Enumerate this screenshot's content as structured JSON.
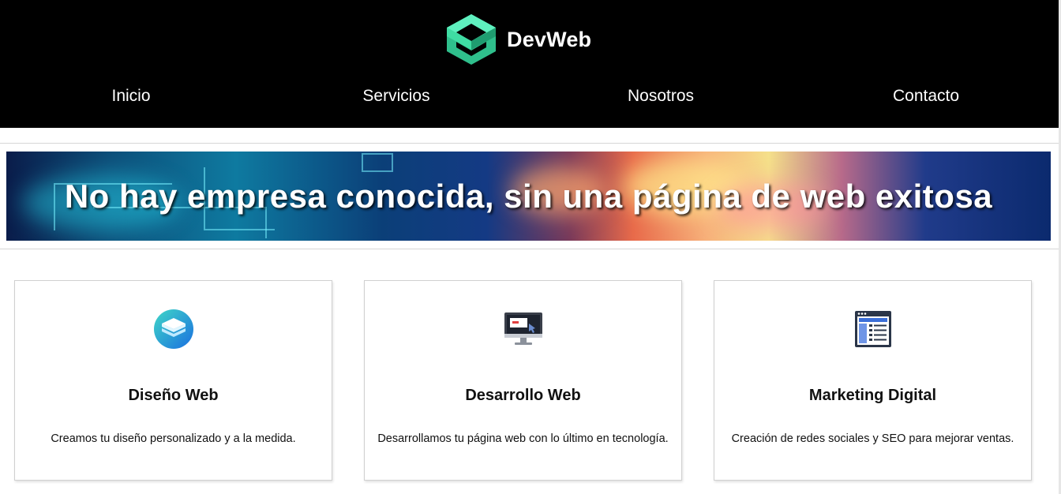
{
  "brand": {
    "name": "DevWeb",
    "logo_icon": "isometric-cube-logo",
    "accent_color": "#3fdca3"
  },
  "nav": {
    "items": [
      {
        "label": "Inicio"
      },
      {
        "label": "Servicios"
      },
      {
        "label": "Nosotros"
      },
      {
        "label": "Contacto"
      }
    ]
  },
  "hero": {
    "title": "No hay empresa conocida, sin una página de web exitosa"
  },
  "services": [
    {
      "icon": "stacked-layers-icon",
      "title": "Diseño Web",
      "description": "Creamos tu diseño personalizado y a la medida."
    },
    {
      "icon": "desktop-monitor-icon",
      "title": "Desarrollo Web",
      "description": "Desarrollamos tu página web con lo último en tecnología."
    },
    {
      "icon": "browser-window-list-icon",
      "title": "Marketing Digital",
      "description": "Creación de redes sociales y SEO para mejorar ventas."
    }
  ]
}
